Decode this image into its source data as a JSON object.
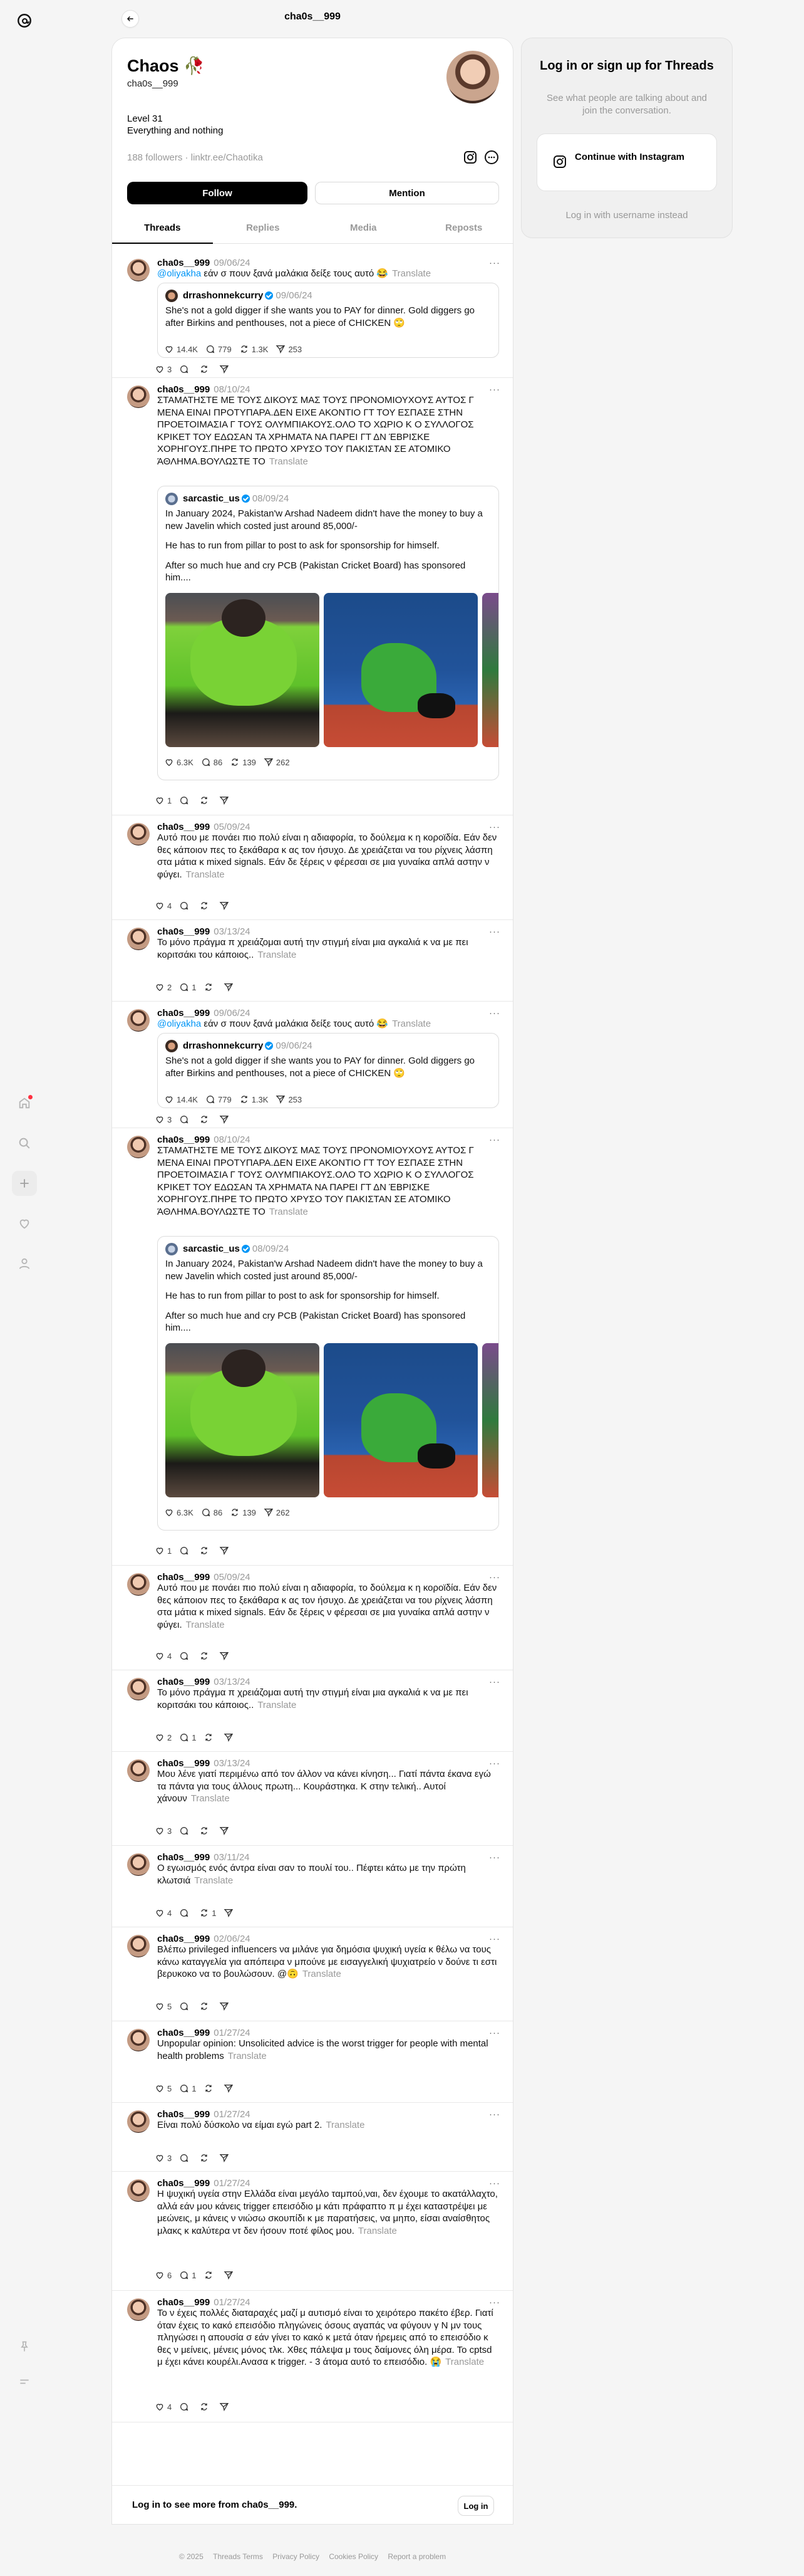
{
  "top": {
    "title": "cha0s__999"
  },
  "profile": {
    "name": "Chaos 🥀",
    "handle": "cha0s__999",
    "bio_line1": "Level 31",
    "bio_line2": "Everything and nothing",
    "followers": "188 followers",
    "separator": " · ",
    "link": "linktr.ee/Chaotika",
    "follow_label": "Follow",
    "mention_label": "Mention"
  },
  "tabs": [
    "Threads",
    "Replies",
    "Media",
    "Reposts"
  ],
  "posts": [
    {
      "user": "cha0s__999",
      "date": "09/06/24",
      "mention": "@oliyakha",
      "text": " εάν σ πουν ξανά μαλάκια δείξε τους αυτό 😂",
      "likes": "3",
      "replies": "",
      "reposts": "",
      "shares": "",
      "quote": {
        "user": "drrashonnekcurry",
        "date": "09/06/24",
        "paragraphs": [
          "She's not a gold digger if she wants you to PAY for dinner. Gold diggers go after Birkins and penthouses, not a piece of CHICKEN 🙄"
        ],
        "likes": "14.4K",
        "replies": "779",
        "reposts": "1.3K",
        "shares": "253"
      }
    },
    {
      "user": "cha0s__999",
      "date": "08/10/24",
      "text": "ΣΤΑΜΑΤΗΣΤΕ ΜΕ ΤΟΥΣ ΔΙΚΟΥΣ ΜΑΣ ΤΟΥΣ ΠΡΟΝΟΜΙΟΥΧΟΥΣ ΑΥΤΟΣ Γ ΜΕΝΑ ΕΙΝΑΙ ΠΡΟΤΥΠΑΡΑ.ΔΕΝ ΕΙΧΕ ΑΚΟΝΤΙΟ ΓΤ ΤΟΥ ΕΣΠΑΣΕ ΣΤΗΝ ΠΡΟΕΤΟΙΜΑΣΙΑ Γ ΤΟΥΣ ΟΛΥΜΠΙΑΚΟΥΣ.ΟΛΟ ΤΟ ΧΩΡΙΟ Κ Ο ΣΥΛΛΟΓΟΣ ΚΡΙΚΕΤ ΤΟΥ ΕΔΩΣΑΝ ΤΑ ΧΡΗΜΑΤΑ ΝΑ ΠΑΡΕΙ ΓΤ ΔΝ ΈΒΡΙΣΚΕ ΧΟΡΗΓΟΥΣ.ΠΗΡΕ ΤΟ ΠΡΩΤΟ ΧΡΥΣΟ ΤΟΥ ΠΑΚΙΣΤΑΝ ΣΕ ΑΤΟΜΙΚΟ ΆΘΛΗΜΑ.ΒΟΥΛΩΣΤΕ ΤΟ",
      "likes": "1",
      "replies": "",
      "reposts": "",
      "shares": "",
      "quote": {
        "user": "sarcastic_us",
        "date": "08/09/24",
        "paragraphs": [
          "In January 2024, Pakistan'w Arshad Nadeem didn't have the money to buy a new Javelin which costed just around 85,000/-",
          "He has to run from pillar to post to ask for sponsorship for himself.",
          "After so much hue and cry PCB (Pakistan Cricket Board) has sponsored him...."
        ],
        "likes": "6.3K",
        "replies": "86",
        "reposts": "139",
        "shares": "262"
      }
    },
    {
      "user": "cha0s__999",
      "date": "05/09/24",
      "text": "Αυτό που με πονάει πιο πολύ είναι η αδιαφορία, το δούλεμα κ η κοροϊδία. Εάν δεν θες κάποιον πες το ξεκάθαρα κ ας τον ήσυχο. Δε χρειάζεται να του ρίχνεις λάσπη στα μάτια κ mixed signals. Εάν δε ξέρεις ν φέρεσαι σε μια γυναίκα απλά αστην ν φύγει.",
      "likes": "4",
      "replies": "",
      "reposts": "",
      "shares": ""
    },
    {
      "user": "cha0s__999",
      "date": "03/13/24",
      "text": "Το μόνο πράγμα π χρειάζομαι αυτή την στιγμή είναι μια αγκαλιά κ να με πει κοριτσάκι του κάποιος..",
      "likes": "2",
      "replies": "1",
      "reposts": "",
      "shares": ""
    },
    {
      "user": "cha0s__999",
      "date": "09/06/24",
      "mention": "@oliyakha",
      "text": " εάν σ πουν ξανά μαλάκια δείξε τους αυτό 😂",
      "likes": "3",
      "replies": "",
      "reposts": "",
      "shares": "",
      "quote": {
        "user": "drrashonnekcurry",
        "date": "09/06/24",
        "paragraphs": [
          "She's not a gold digger if she wants you to PAY for dinner. Gold diggers go after Birkins and penthouses, not a piece of CHICKEN 🙄"
        ],
        "likes": "14.4K",
        "replies": "779",
        "reposts": "1.3K",
        "shares": "253"
      }
    },
    {
      "user": "cha0s__999",
      "date": "08/10/24",
      "text": "ΣΤΑΜΑΤΗΣΤΕ ΜΕ ΤΟΥΣ ΔΙΚΟΥΣ ΜΑΣ ΤΟΥΣ ΠΡΟΝΟΜΙΟΥΧΟΥΣ ΑΥΤΟΣ Γ ΜΕΝΑ ΕΙΝΑΙ ΠΡΟΤΥΠΑΡΑ.ΔΕΝ ΕΙΧΕ ΑΚΟΝΤΙΟ ΓΤ ΤΟΥ ΕΣΠΑΣΕ ΣΤΗΝ ΠΡΟΕΤΟΙΜΑΣΙΑ Γ ΤΟΥΣ ΟΛΥΜΠΙΑΚΟΥΣ.ΟΛΟ ΤΟ ΧΩΡΙΟ Κ Ο ΣΥΛΛΟΓΟΣ ΚΡΙΚΕΤ ΤΟΥ ΕΔΩΣΑΝ ΤΑ ΧΡΗΜΑΤΑ ΝΑ ΠΑΡΕΙ ΓΤ ΔΝ ΈΒΡΙΣΚΕ ΧΟΡΗΓΟΥΣ.ΠΗΡΕ ΤΟ ΠΡΩΤΟ ΧΡΥΣΟ ΤΟΥ ΠΑΚΙΣΤΑΝ ΣΕ ΑΤΟΜΙΚΟ ΆΘΛΗΜΑ.ΒΟΥΛΩΣΤΕ ΤΟ",
      "likes": "1",
      "replies": "",
      "reposts": "",
      "shares": "",
      "quote": {
        "user": "sarcastic_us",
        "date": "08/09/24",
        "paragraphs": [
          "In January 2024, Pakistan'w Arshad Nadeem didn't have the money to buy a new Javelin which costed just around 85,000/-",
          "He has to run from pillar to post to ask for sponsorship for himself.",
          "After so much hue and cry PCB (Pakistan Cricket Board) has sponsored him...."
        ],
        "likes": "6.3K",
        "replies": "86",
        "reposts": "139",
        "shares": "262"
      }
    },
    {
      "user": "cha0s__999",
      "date": "05/09/24",
      "text": "Αυτό που με πονάει πιο πολύ είναι η αδιαφορία, το δούλεμα κ η κοροϊδία. Εάν δεν θες κάποιον πες το ξεκάθαρα κ ας τον ήσυχο. Δε χρειάζεται να του ρίχνεις λάσπη στα μάτια κ mixed signals. Εάν δε ξέρεις ν φέρεσαι σε μια γυναίκα απλά αστην ν φύγει.",
      "likes": "4",
      "replies": "",
      "reposts": "",
      "shares": ""
    },
    {
      "user": "cha0s__999",
      "date": "03/13/24",
      "text": "Το μόνο πράγμα π χρειάζομαι αυτή την στιγμή είναι μια αγκαλιά κ να με πει κοριτσάκι του κάποιος..",
      "likes": "2",
      "replies": "1",
      "reposts": "",
      "shares": ""
    },
    {
      "user": "cha0s__999",
      "date": "03/13/24",
      "text": "Μου λένε γιατί περιμένω από τον άλλον να κάνει κίνηση... Γιατί πάντα έκανα εγώ τα πάντα για τους άλλους πρωτη... Κουράστηκα. Κ στην τελική.. Αυτοί χάνουν",
      "likes": "3",
      "replies": "",
      "reposts": "",
      "shares": ""
    },
    {
      "user": "cha0s__999",
      "date": "03/11/24",
      "text": "Ο εγωισμός ενός άντρα είναι σαν το πουλί του.. Πέφτει κάτω με την πρώτη κλωτσιά",
      "likes": "4",
      "replies": "",
      "reposts": "1",
      "shares": ""
    },
    {
      "user": "cha0s__999",
      "date": "02/06/24",
      "text": "Βλέπω privileged influencers να μιλάνε για δημόσια ψυχική υγεία κ θέλω να τους κάνω καταγγελία για απόπειρα ν μπούνε με εισαγγελική ψυχιατρείο ν δούνε τι εστι βερυκοκο να το βουλώσουν. @🙃",
      "likes": "5",
      "replies": "",
      "reposts": "",
      "shares": ""
    },
    {
      "user": "cha0s__999",
      "date": "01/27/24",
      "text": "Unpopular opinion: Unsolicited advice is the worst trigger for people with mental health problems",
      "likes": "5",
      "replies": "1",
      "reposts": "",
      "shares": ""
    },
    {
      "user": "cha0s__999",
      "date": "01/27/24",
      "text": "Είναι πολύ δύσκολο να είμαι εγώ part 2.",
      "likes": "3",
      "replies": "",
      "reposts": "",
      "shares": ""
    },
    {
      "user": "cha0s__999",
      "date": "01/27/24",
      "text": "Η ψυχική υγεία στην Ελλάδα είναι μεγάλο ταμπού,ναι, δεν έχουμε το ακατάλλαχτο, αλλά εάν μου κάνεις trigger επεισόδιο μ κάτι πράφαπτο π μ έχει καταστρέψει με μεώνεις, μ κάνεις ν νιώσω σκουπίδι κ με παρατήσεις, να μηπο, είσαι αναίσθητος μλακς κ καλύτερα ντ δεν ήσουν ποτέ φίλος μου.",
      "likes": "6",
      "replies": "1",
      "reposts": "",
      "shares": ""
    },
    {
      "user": "cha0s__999",
      "date": "01/27/24",
      "text": "Το ν έχεις πολλές διαταραχές μαζί μ αυτισμό είναι το χειρότερο πακέτο έβερ. Γιατί όταν έχεις το κακό επεισόδιο πληγώνεις όσους αγαπάς να φύγουν γ Ν μν τους πληγώσει η απουσία σ εάν γίνει το κακό κ μετά όταν ήρεμεις από το επεισόδιο κ θες ν μείνεις, μένεις μόνος τλκ. Χθες πάλεψα μ τους δαίμονες όλη μέρα. Το cptsd μ έχει κάνει κουρέλι.Ανασα κ trigger. - 3 άτομα αυτό το επεισόδιο. 😭",
      "likes": "4",
      "replies": "",
      "reposts": "",
      "shares": ""
    }
  ],
  "translate_label": "Translate",
  "login_strip": {
    "text": "Log in to see more from cha0s__999.",
    "button": "Log in"
  },
  "card": {
    "title": "Log in or sign up for Threads",
    "subtitle": "See what people are talking about and join the conversation.",
    "instagram_button": "Continue with Instagram",
    "username_link": "Log in with username instead"
  },
  "footer": [
    "© 2025",
    "Threads Terms",
    "Privacy Policy",
    "Cookies Policy",
    "Report a problem"
  ],
  "colors": {
    "accent_blue": "#0095f6",
    "notification_red": "#ff3040"
  }
}
